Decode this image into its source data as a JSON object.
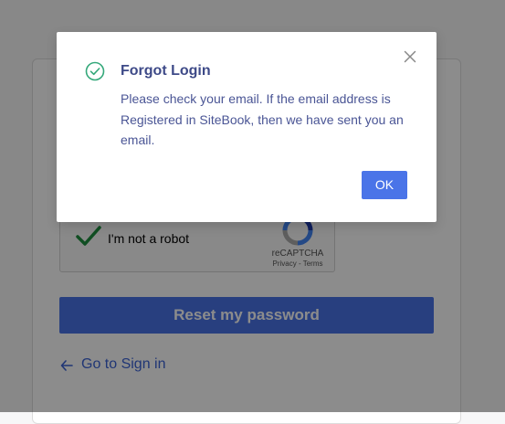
{
  "background_page": {
    "captcha": {
      "label": "I'm not a robot",
      "brand": "reCAPTCHA",
      "links": "Privacy - Terms",
      "checked": true,
      "icons": [
        "checkmark-icon",
        "recaptcha-logo-icon"
      ]
    },
    "reset_button_label": "Reset my password",
    "go_signin_label": "Go to Sign in",
    "go_signin_icon": "arrow-left-icon"
  },
  "modal": {
    "title": "Forgot Login",
    "message": "Please check your email. If the email address is Registered in SiteBook, then we have sent you an email.",
    "ok_label": "OK",
    "icons": {
      "status": "check-circle-icon",
      "close": "close-icon"
    }
  },
  "colors": {
    "primary": "#4a74e8",
    "success": "#34a87a",
    "modal_title": "#3e4a88",
    "modal_text": "#4a5595",
    "link": "#3b63d6",
    "overlay": "rgba(0, 0, 0, 0.45)"
  }
}
